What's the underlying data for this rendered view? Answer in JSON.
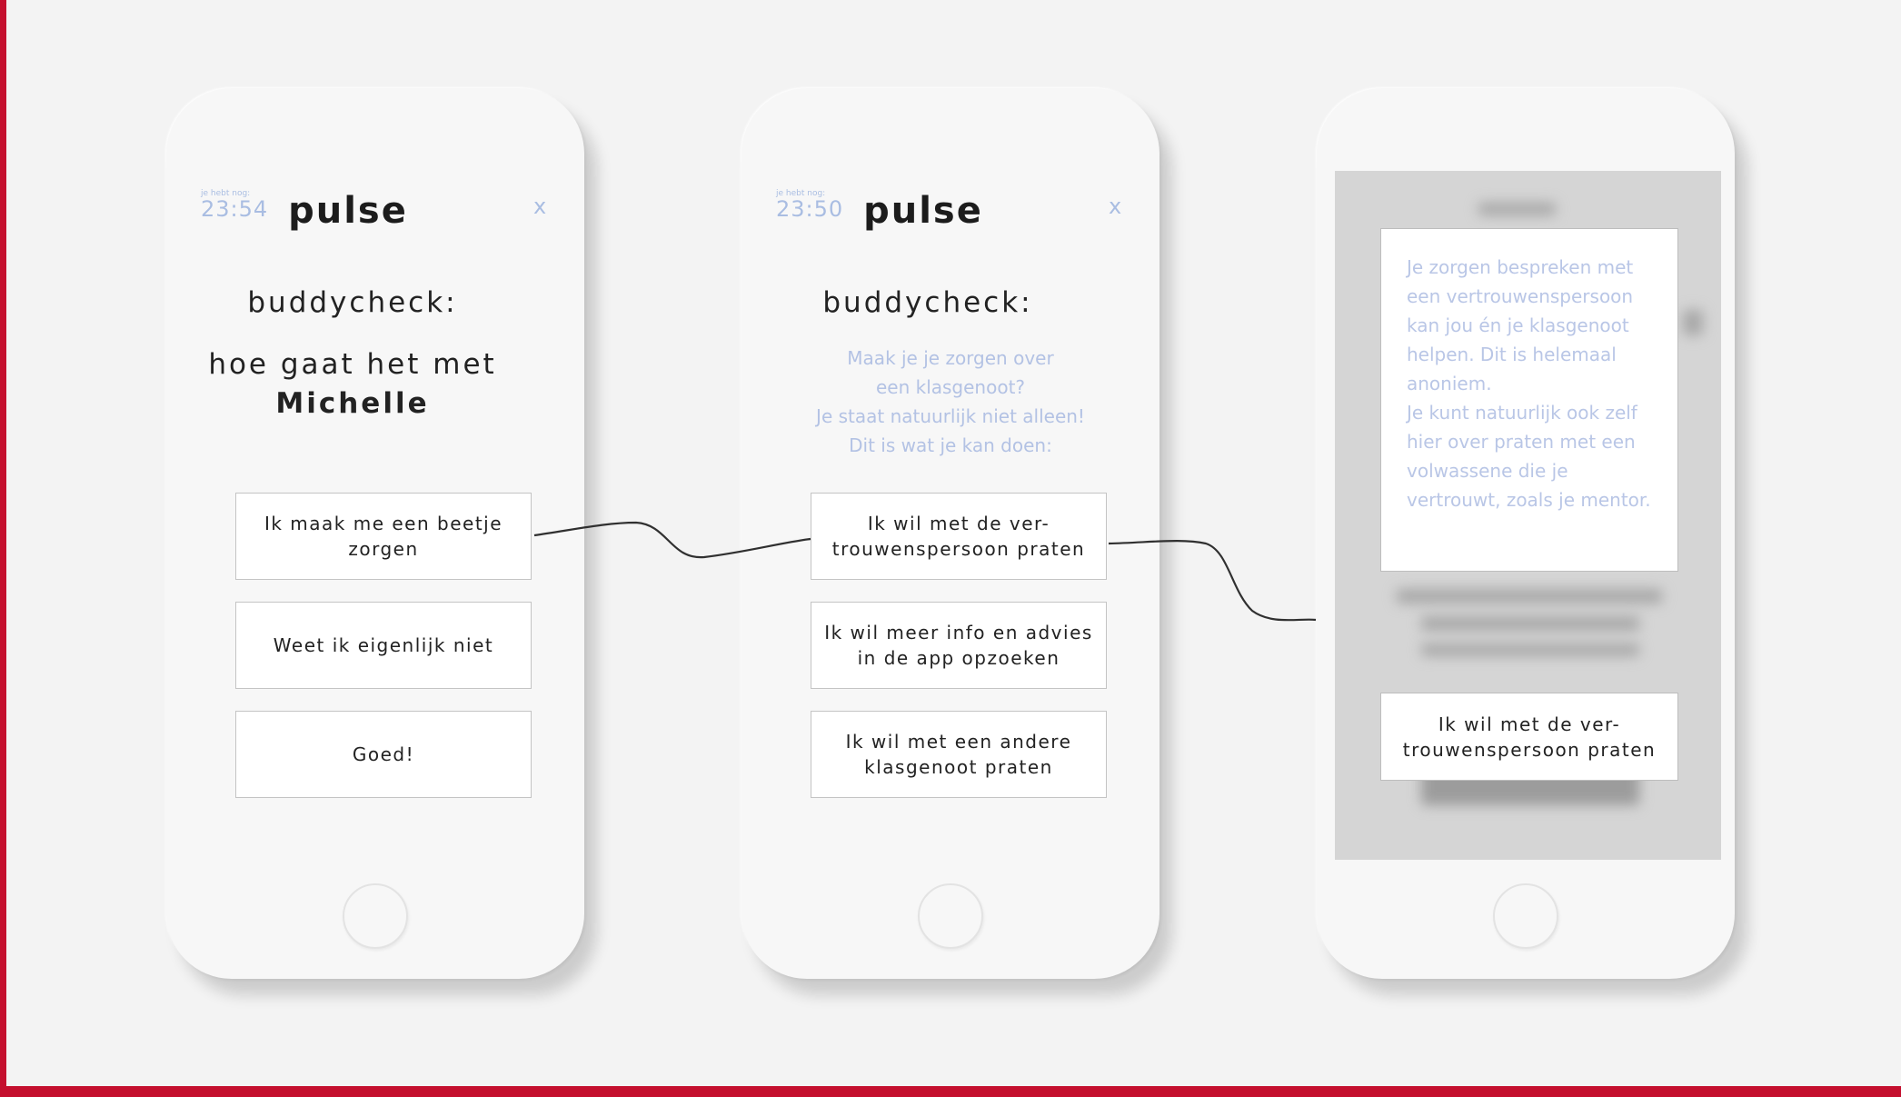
{
  "phones": [
    {
      "timer_label": "je hebt nog:",
      "timer": "23:54",
      "logo": "pulse",
      "close": "x",
      "heading": "buddycheck:",
      "question": "hoe gaat het met",
      "name": "Michelle",
      "options": [
        "Ik maak me een beetje zorgen",
        "Weet ik eigenlijk niet",
        "Goed!"
      ]
    },
    {
      "timer_label": "je hebt nog:",
      "timer": "23:50",
      "logo": "pulse",
      "close": "x",
      "heading": "buddycheck:",
      "info_lines": [
        "Maak je je zorgen over",
        "een klasgenoot?",
        "Je staat natuurlijk niet alleen!",
        "Dit is wat je kan doen:"
      ],
      "options": [
        "Ik wil met de ver-trouwenspersoon praten",
        "Ik wil meer info en advies in de app opzoeken",
        "Ik wil met een andere klasgenoot praten"
      ]
    },
    {
      "info_paragraphs": [
        "Je zorgen bespreken met een vertrouwenspersoon kan jou én je klasgenoot helpen. Dit is helemaal anoniem.",
        "Je kunt natuurlijk ook zelf hier over praten met een volwassene die je vertrouwt, zoals je mentor."
      ],
      "option": "Ik wil met de ver-trouwenspersoon praten"
    }
  ],
  "colors": {
    "frame": "#c40f2e",
    "accent_text": "#a9bde2",
    "background": "#f3f3f3"
  }
}
